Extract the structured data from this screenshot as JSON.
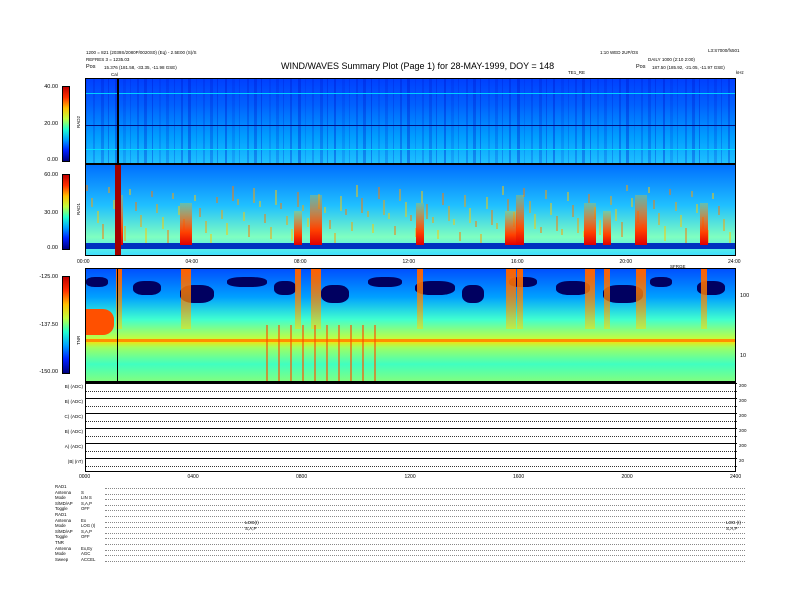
{
  "header": {
    "title": "WIND/WAVES Summary Plot (Page 1) for 28-MAY-1999, DOY = 148",
    "left_line1": "1200 = 821 (2039S/2080P/0020S0) (Eq) - 2.5E00 (S)/S",
    "left_line2": "REFRES 3 = 1235.03",
    "left_pos_label": "Pos",
    "left_pos_value": "15.376 (181.58, -33.35, -11.98 GSE)",
    "right_line0": "L3:S7000/fs501",
    "right_line1": "1:10 WED 2UP/OS",
    "right_line2": "DAILY 1000 (2:10 2:00)",
    "right_pos_label": "Pos",
    "right_pos_value": "187.50 (185.92, -21.05, -11.97 GSE)",
    "cal_label": "Cal",
    "mid_label": "TE1_RE",
    "right_mark": "kHz"
  },
  "panels": {
    "rad2": {
      "label": "RAD2",
      "ticks": [
        "40.00",
        "20.00",
        "0.00"
      ]
    },
    "rad1": {
      "label": "RAD1",
      "ticks": [
        "60.00",
        "30.00",
        "0.00"
      ]
    },
    "tnr": {
      "label": "TNR",
      "ticks": [
        "-125.00",
        "-137.50",
        "-150.00"
      ],
      "right_ticks": [
        "100",
        "10"
      ],
      "corner_label": "SFRGE"
    }
  },
  "time_axis": {
    "ticks": [
      "00:00",
      "04:00",
      "08:00",
      "12:00",
      "16:00",
      "20:00",
      "24:00"
    ],
    "bottom_ticks": [
      "0000",
      "0400",
      "0800",
      "1200",
      "1600",
      "2000",
      "2400"
    ]
  },
  "strips": [
    {
      "label": "B) (ADC)",
      "right": "200"
    },
    {
      "label": "B) (ADC)",
      "right": "200"
    },
    {
      "label": "C) (ADC)",
      "right": "200"
    },
    {
      "label": "B) (ADC)",
      "right": "200"
    },
    {
      "label": "A) (ADC)",
      "right": "200"
    },
    {
      "label": "|B| (nT)",
      "right": "20"
    }
  ],
  "footer_rows": [
    {
      "k": "RAD1",
      "v": ""
    },
    {
      "k": "Antenna",
      "v": "S"
    },
    {
      "k": "Mode",
      "v": "LIN S"
    },
    {
      "k": "S/MD/AP",
      "v": "S,A,P"
    },
    {
      "k": "Toggle",
      "v": "OFF"
    },
    {
      "k": "RAD1",
      "v": ""
    },
    {
      "k": "Antenna",
      "v": "Ex"
    },
    {
      "k": "Mode",
      "v": "LOG (I)"
    },
    {
      "k": "S/MD/AP",
      "v": "S,A,P"
    },
    {
      "k": "Toggle",
      "v": "OFF"
    },
    {
      "k": "TNR",
      "v": ""
    },
    {
      "k": "Antenna",
      "v": "Ex,Ey"
    },
    {
      "k": "Mode",
      "v": "AGC"
    },
    {
      "k": "Sweep",
      "v": "ACCEL"
    }
  ],
  "footer_mid": "LOG(I)",
  "footer_mid2": "S,A,P",
  "footer_right": "LOG (I)",
  "footer_right2": "S,A,P",
  "chart_data": {
    "type": "heatmap",
    "title": "WIND/WAVES Summary Plot (Page 1) for 28-MAY-1999, DOY = 148",
    "x_range": [
      0,
      24
    ],
    "x_unit": "hours UT",
    "subplots": [
      {
        "name": "RAD2",
        "colorbar_range": [
          0,
          40
        ],
        "colorbar_ticks": [
          40,
          20,
          0
        ]
      },
      {
        "name": "RAD1",
        "colorbar_range": [
          0,
          60
        ],
        "colorbar_ticks": [
          60,
          30,
          0
        ]
      },
      {
        "name": "TNR",
        "colorbar_range": [
          -150,
          -125
        ],
        "colorbar_ticks": [
          -125,
          -137.5,
          -150
        ],
        "freq_ticks_khz": [
          100,
          10
        ]
      }
    ],
    "radio_bursts_hours": [
      1.2,
      3.6,
      7.8,
      8.4,
      12.3,
      15.6,
      16.0,
      18.5,
      19.2,
      20.4,
      22.8
    ],
    "cal_marker_hour": 1.15,
    "strip_count": 6
  }
}
